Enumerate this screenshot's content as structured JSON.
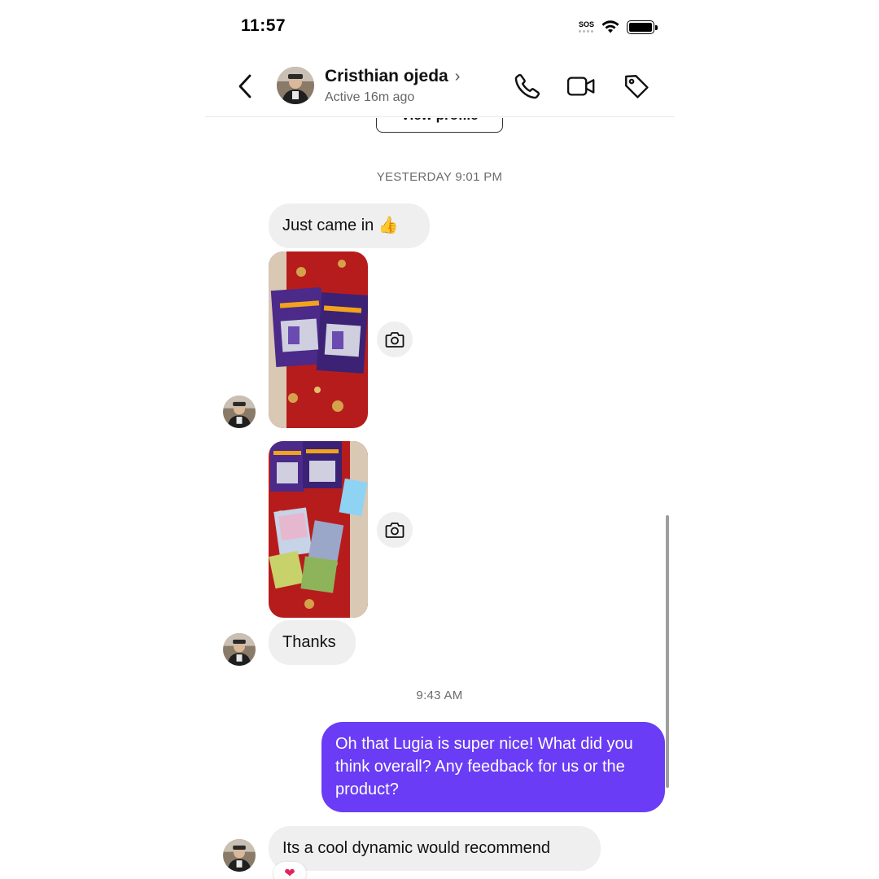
{
  "status_bar": {
    "time": "11:57",
    "sos": "SOS"
  },
  "header": {
    "contact_name": "Cristhian ojeda",
    "chevron": "›",
    "status": "Active 16m ago",
    "icons": [
      "back-icon",
      "phone-icon",
      "video-camera-icon",
      "tag-icon"
    ]
  },
  "chat": {
    "view_profile_label": "View profile",
    "timestamps": {
      "first": "YESTERDAY 9:01 PM",
      "second": "9:43 AM"
    },
    "messages": {
      "m1": "Just came in 👍",
      "m4": "Thanks",
      "m5": "Oh that Lugia is super nice! What did you think overall? Any feedback for us or the product?",
      "m6": "Its a cool dynamic would recommend"
    },
    "reaction": "❤",
    "colors": {
      "outgoing_bubble": "#6a3cf5",
      "incoming_bubble": "#efefef"
    }
  }
}
